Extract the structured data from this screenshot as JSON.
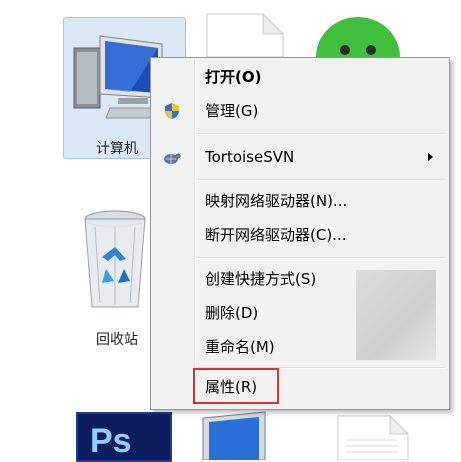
{
  "desktop": {
    "icons": [
      {
        "label": "计算机"
      },
      {
        "label": "回收站"
      }
    ]
  },
  "context_menu": {
    "items": [
      {
        "label": "打开(O)",
        "bold": true
      },
      {
        "label": "管理(G)",
        "icon": "uac-shield-icon"
      },
      {
        "label": "TortoiseSVN",
        "icon": "tortoisesvn-icon",
        "submenu": true
      },
      {
        "label": "映射网络驱动器(N)..."
      },
      {
        "label": "断开网络驱动器(C)..."
      },
      {
        "label": "创建快捷方式(S)"
      },
      {
        "label": "删除(D)"
      },
      {
        "label": "重命名(M)"
      },
      {
        "label": "属性(R)",
        "highlighted": true
      }
    ]
  },
  "colors": {
    "highlight_border": "#e0312e",
    "selection_bg": "#dbe9f7"
  },
  "bottom_icons": {
    "ps_label": "Ps"
  }
}
